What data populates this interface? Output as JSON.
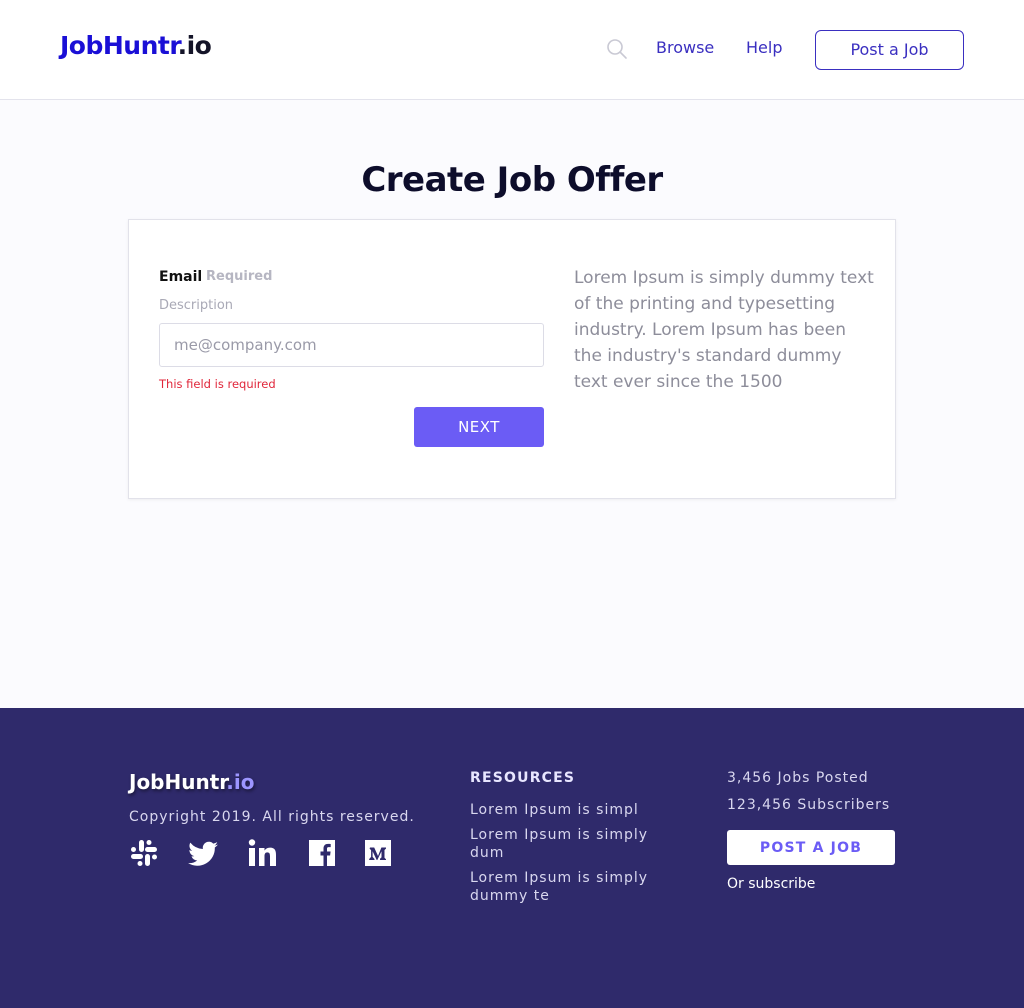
{
  "header": {
    "logo_main": "JobHuntr",
    "logo_tld": ".io",
    "nav": {
      "browse": "Browse",
      "help": "Help"
    },
    "post_button": "Post a Job",
    "accent": "#3a2fc0"
  },
  "main": {
    "title": "Create Job Offer",
    "form": {
      "label": "Email",
      "required": "Required",
      "description": "Description",
      "email_value": "",
      "email_placeholder": "me@company.com",
      "error": "This field is required",
      "next_button": "NEXT"
    },
    "side_text": "Lorem Ipsum is simply dummy text of the printing and typesetting industry. Lorem Ipsum has been the industry's standard dummy text ever since the 1500"
  },
  "footer": {
    "logo_main": "JobHuntr",
    "logo_tld": ".io",
    "copyright": "Copyright 2019. All rights reserved.",
    "socials": [
      "slack-icon",
      "twitter-icon",
      "linkedin-icon",
      "facebook-icon",
      "medium-icon"
    ],
    "resources_title": "RESOURCES",
    "resources": [
      "Lorem Ipsum is simpl",
      "Lorem Ipsum is simply dum",
      "Lorem Ipsum is simply dummy te"
    ],
    "stats": {
      "jobs": "3,456 Jobs Posted",
      "subscribers": "123,456 Subscribers"
    },
    "post_button": "POST A JOB",
    "subscribe": "Or subscribe",
    "background": "#2f2a6b"
  }
}
